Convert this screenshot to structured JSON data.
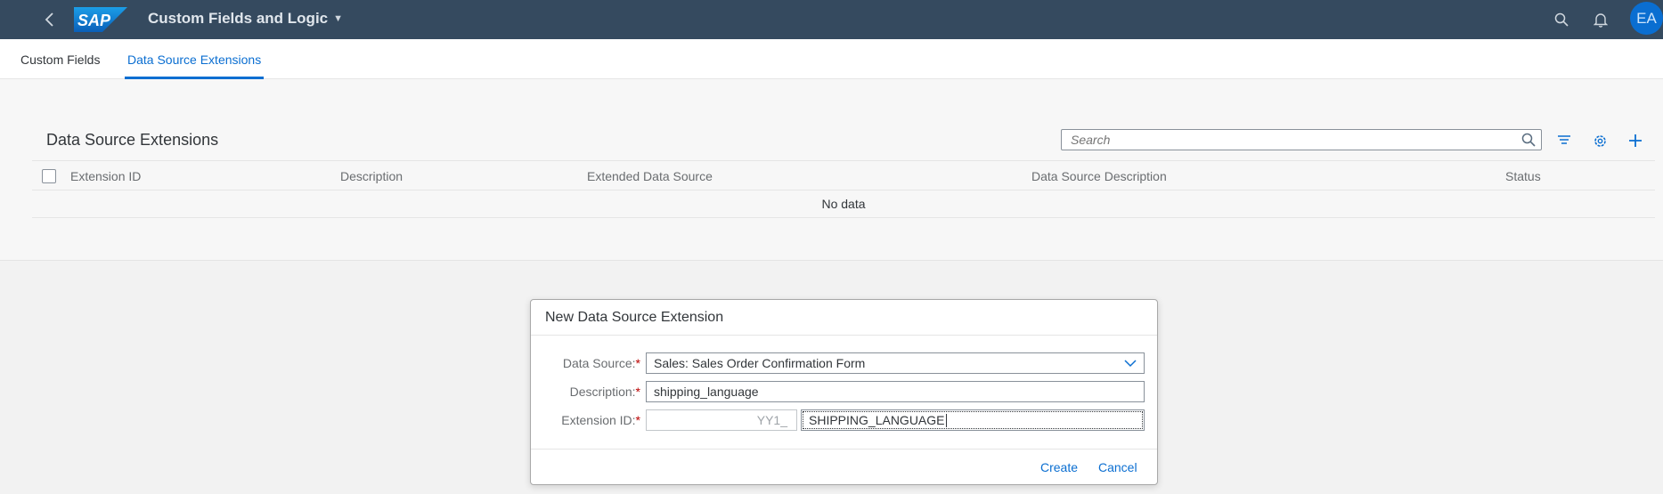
{
  "shell": {
    "logo_text": "SAP",
    "app_title": "Custom Fields and Logic",
    "avatar_initials": "EA"
  },
  "tabs": [
    {
      "label": "Custom Fields",
      "active": false
    },
    {
      "label": "Data Source Extensions",
      "active": true
    }
  ],
  "table": {
    "title": "Data Source Extensions",
    "search_placeholder": "Search",
    "columns": [
      "Extension ID",
      "Description",
      "Extended Data Source",
      "Data Source Description",
      "Status"
    ],
    "empty_text": "No data"
  },
  "dialog": {
    "title": "New Data Source Extension",
    "data_source_label": "Data Source:",
    "data_source_value": "Sales: Sales Order Confirmation Form",
    "description_label": "Description:",
    "description_value": "shipping_language",
    "extension_id_label": "Extension ID:",
    "extension_id_prefix": "YY1_",
    "extension_id_value": "SHIPPING_LANGUAGE",
    "required_marker": "*",
    "create_label": "Create",
    "cancel_label": "Cancel"
  },
  "colors": {
    "shell_bg": "#354a5f",
    "accent": "#0a6ed1",
    "required": "#bb0000"
  }
}
